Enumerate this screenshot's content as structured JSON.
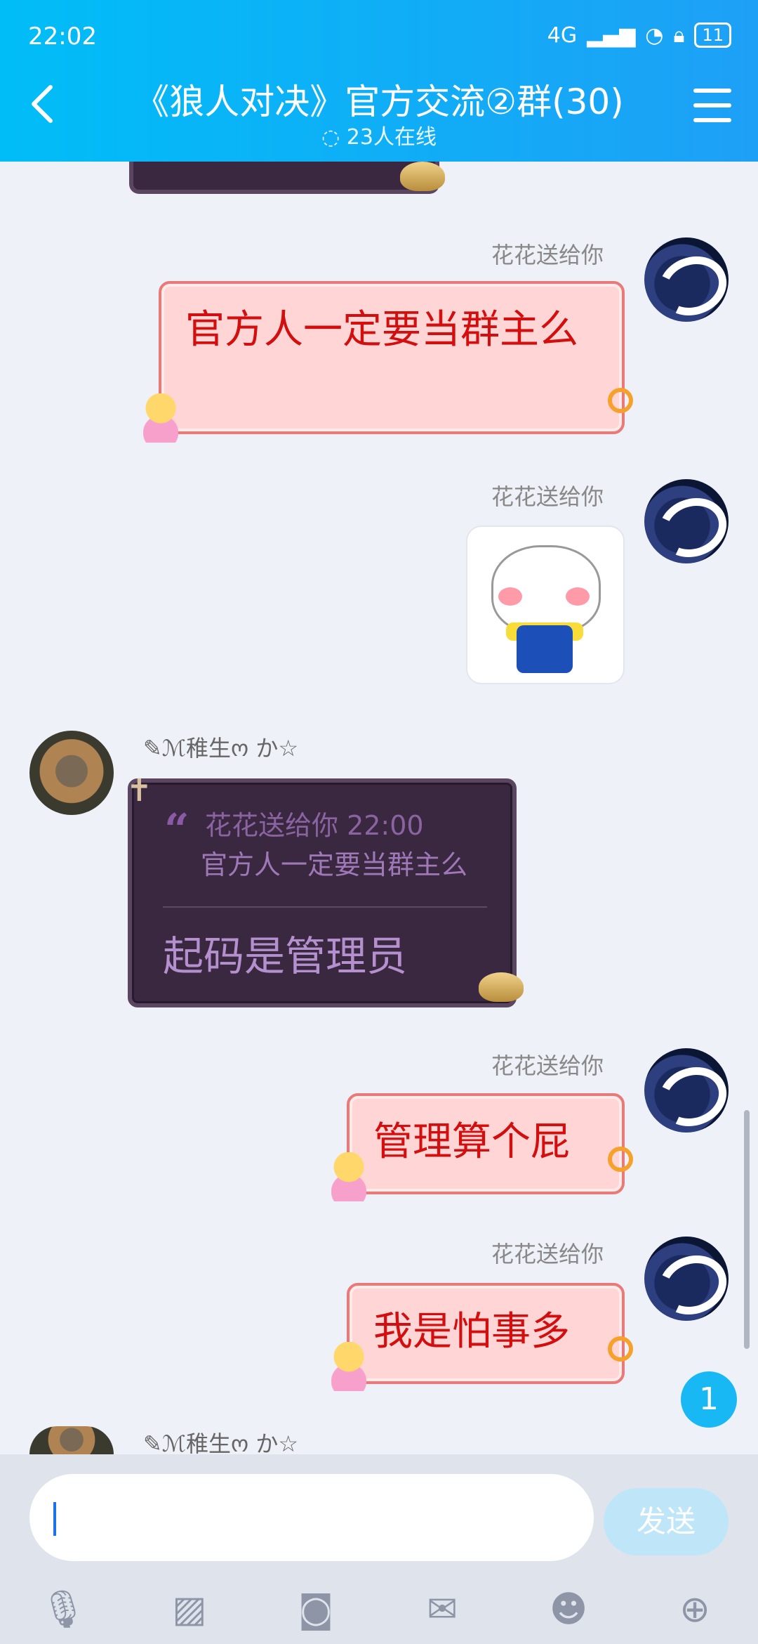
{
  "status": {
    "time": "22:02",
    "signal": "4G",
    "battery": "11"
  },
  "header": {
    "title": "《狼人对决》官方交流②群(30)",
    "online": "23人在线"
  },
  "messages": {
    "m1": {
      "sender": "花花送给你",
      "text": "官方人一定要当群主么"
    },
    "m2": {
      "sender": "花花送给你"
    },
    "m3": {
      "sender": "✎ℳ稚生ო か☆",
      "quote_source": "花花送给你 22:00",
      "quote_text": "官方人一定要当群主么",
      "reply": "起码是管理员"
    },
    "m4": {
      "sender": "花花送给你",
      "text": "管理算个屁"
    },
    "m5": {
      "sender": "花花送给你",
      "text": "我是怕事多"
    },
    "m6": {
      "sender": "✎ℳ稚生ო か☆"
    }
  },
  "badge": "1",
  "composer": {
    "send_label": "发送"
  },
  "icons": {
    "voice": "mic-icon",
    "image": "image-icon",
    "camera": "camera-icon",
    "redpacket": "redpacket-icon",
    "emoji": "emoji-icon",
    "plus": "plus-icon"
  }
}
